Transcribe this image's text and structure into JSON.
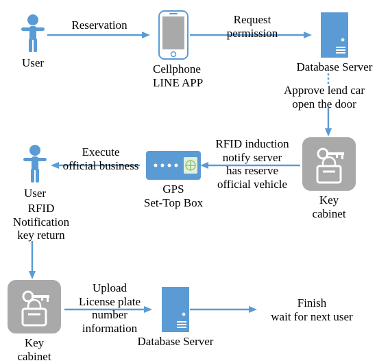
{
  "nodes": {
    "user1": "User",
    "phone": "Cellphone\nLINE APP",
    "server1": "Database Server",
    "cabinet1": "Key cabinet",
    "gps": "GPS\nSet-Top Box",
    "user2": "User",
    "cabinet2": "Key cabinet",
    "server2": "Database Server",
    "finish": "Finish\nwait for next user"
  },
  "edges": {
    "reservation": "Reservation",
    "request": "Request\npermission",
    "approve": "Approve lend car\nopen the door",
    "rfid_induction": "RFID induction\nnotify server\nhas reserve\nofficial vehicle",
    "execute": "Execute\nofficial business",
    "rfid_return": "RFID\nNotification\nkey return",
    "upload": "Upload\nLicense plate\nnumber\ninformation"
  }
}
